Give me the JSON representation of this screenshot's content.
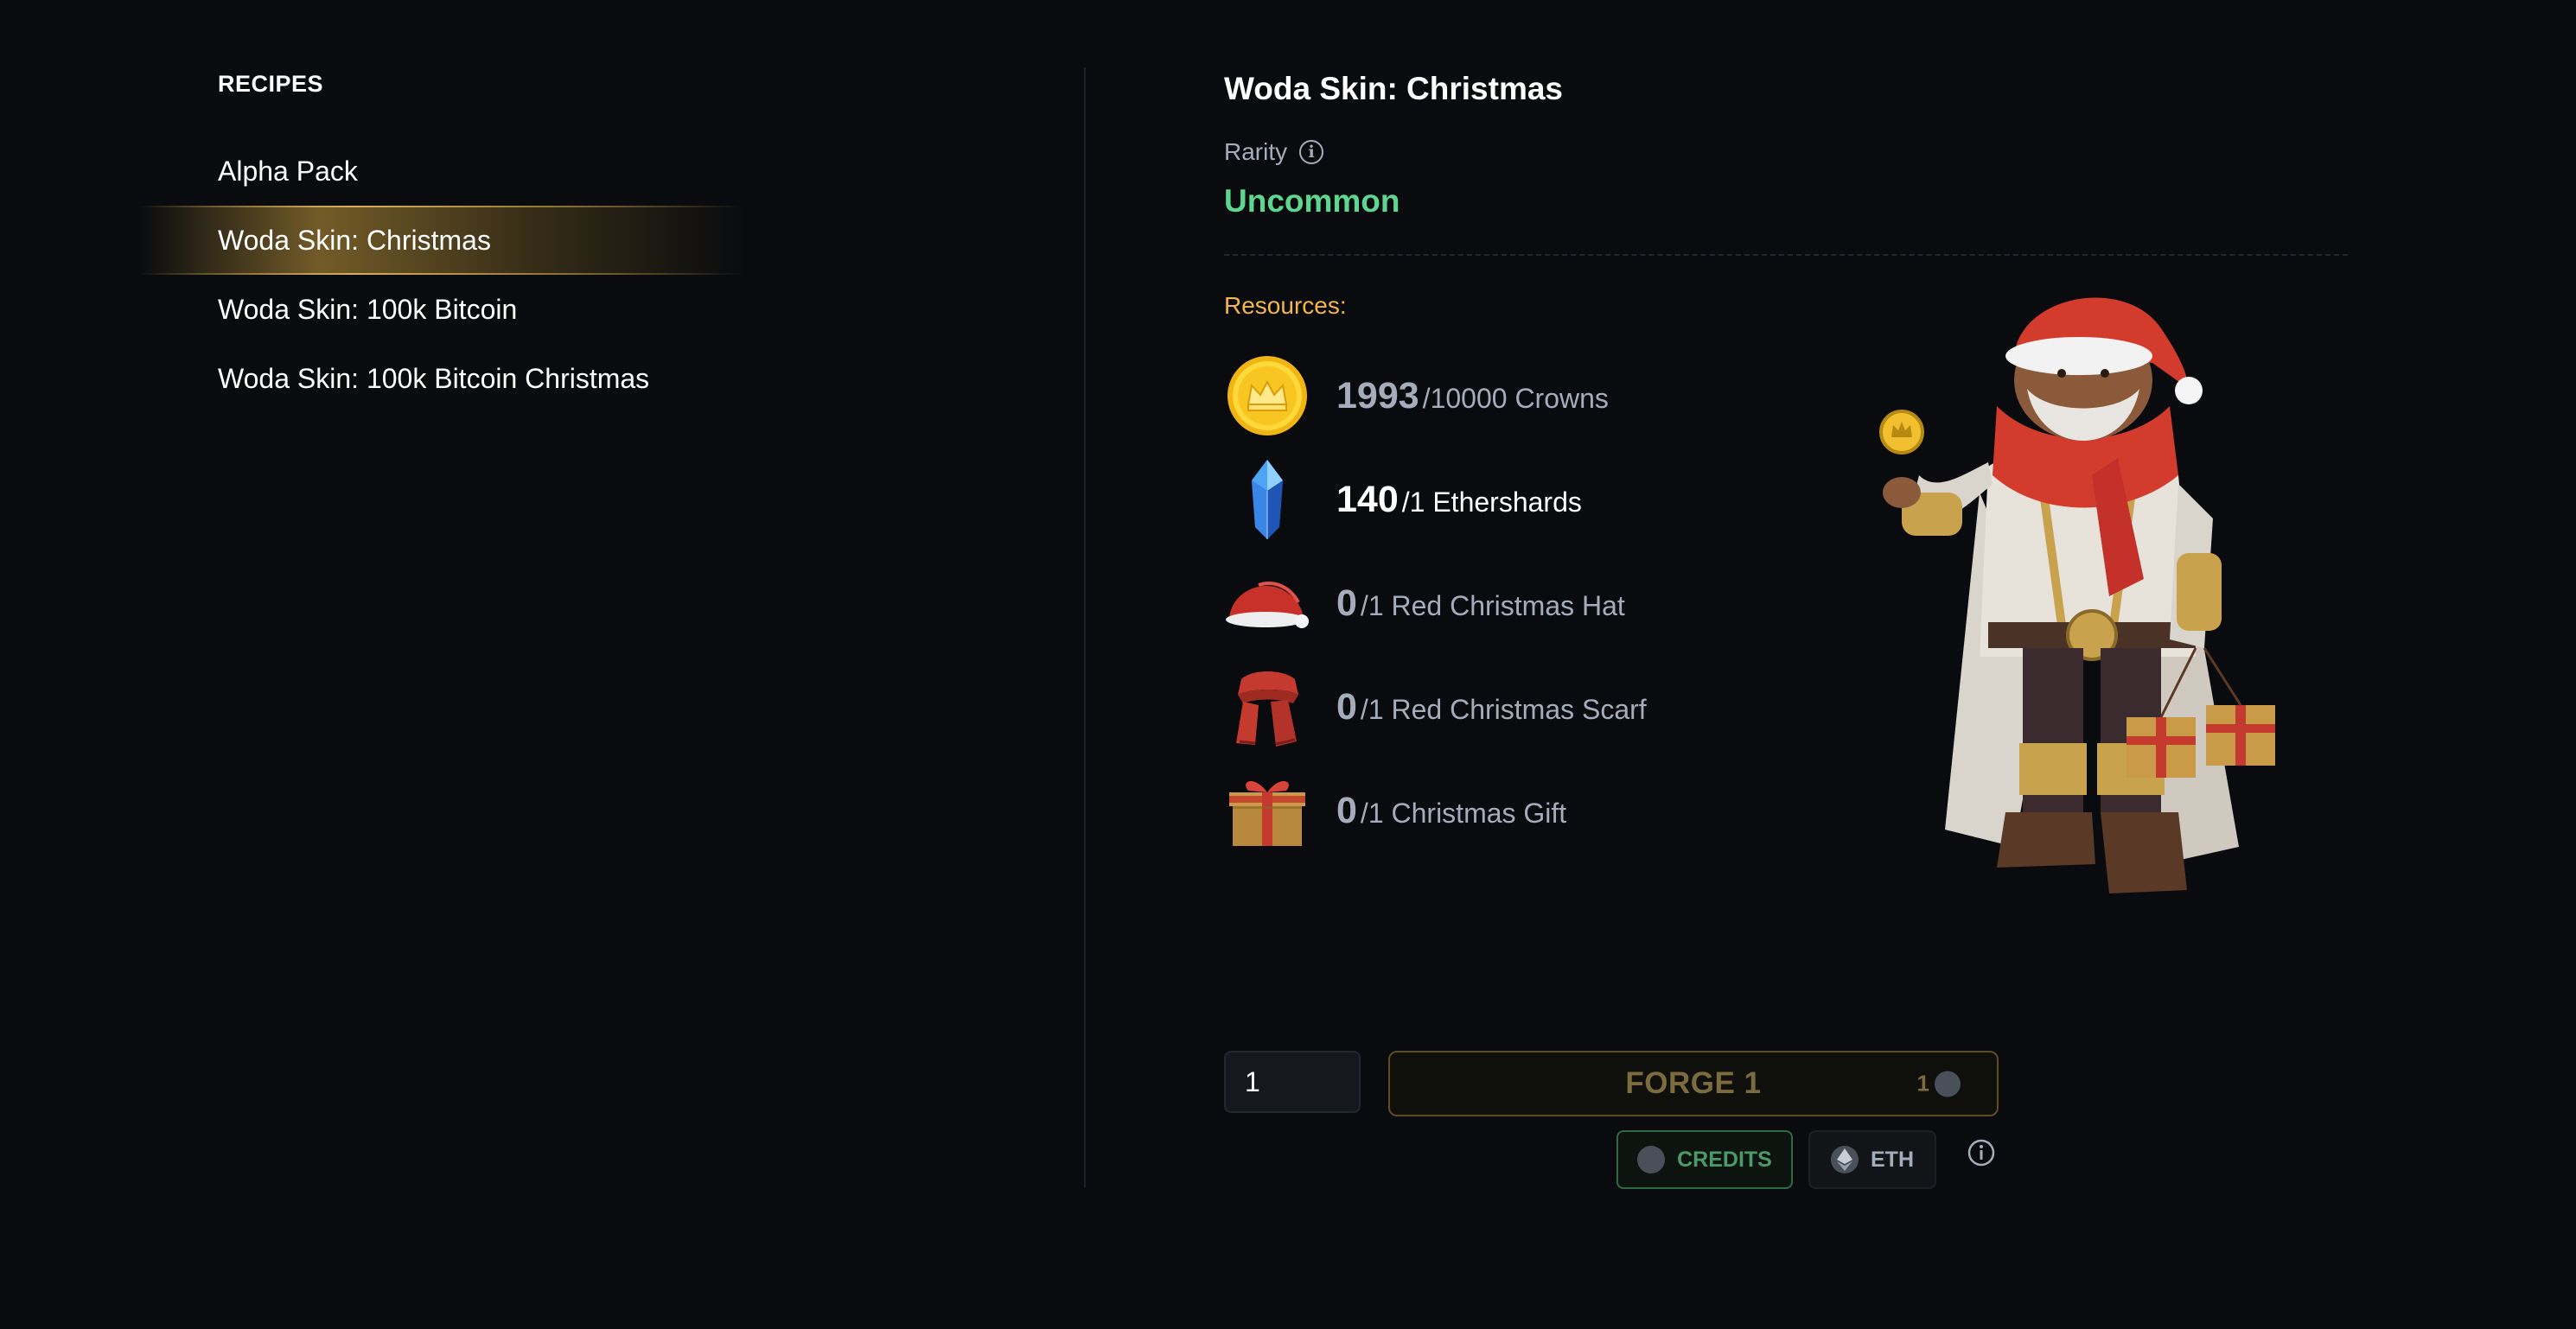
{
  "sidebar": {
    "title": "RECIPES",
    "items": [
      {
        "label": "Alpha Pack",
        "active": false
      },
      {
        "label": "Woda Skin: Christmas",
        "active": true
      },
      {
        "label": "Woda Skin: 100k Bitcoin",
        "active": false
      },
      {
        "label": "Woda Skin: 100k Bitcoin Christmas",
        "active": false
      }
    ]
  },
  "detail": {
    "title": "Woda Skin: Christmas",
    "rarity_label": "Rarity",
    "rarity_value": "Uncommon",
    "resources_label": "Resources:",
    "resources": [
      {
        "have": "1993",
        "need": "/10000 Crowns",
        "icon": "crown-coin-icon",
        "sufficient": false
      },
      {
        "have": "140",
        "need": "/1 Ethershards",
        "icon": "ethershard-crystal-icon",
        "sufficient": true
      },
      {
        "have": "0",
        "need": "/1 Red Christmas Hat",
        "icon": "christmas-hat-icon",
        "sufficient": false
      },
      {
        "have": "0",
        "need": "/1 Red Christmas Scarf",
        "icon": "christmas-scarf-icon",
        "sufficient": false
      },
      {
        "have": "0",
        "need": "/1 Christmas Gift",
        "icon": "christmas-gift-icon",
        "sufficient": false
      }
    ]
  },
  "forge": {
    "quantity": "1",
    "button_label": "FORGE 1",
    "cost": "1"
  },
  "payment": {
    "credits_label": "CREDITS",
    "eth_label": "ETH",
    "selected": "CREDITS"
  },
  "colors": {
    "background": "#090b0e",
    "rarity_uncommon": "#5fd68f",
    "resources_label": "#f2b64d",
    "muted_text": "#a5acbb",
    "forge_border": "#5b4d26",
    "credits_accent": "#2c6a44"
  }
}
